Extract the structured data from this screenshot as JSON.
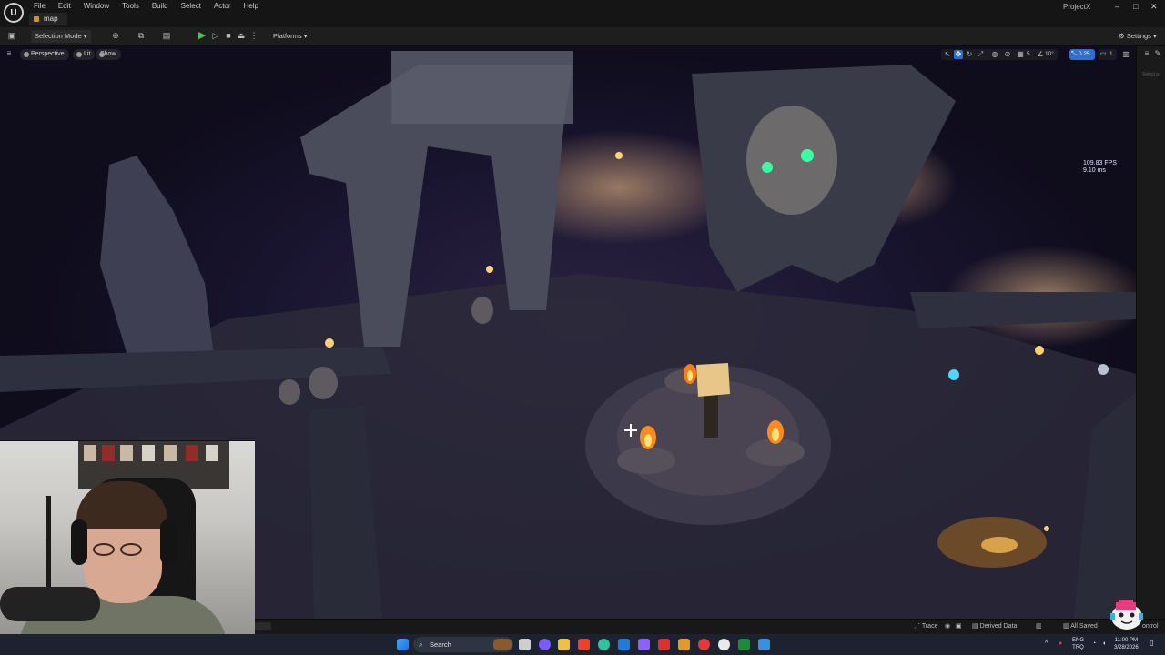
{
  "app": {
    "project_name": "ProjectX",
    "map_tab": "map",
    "menu": [
      "File",
      "Edit",
      "Window",
      "Tools",
      "Build",
      "Select",
      "Actor",
      "Help"
    ]
  },
  "toolbar": {
    "selection_mode": "Selection Mode",
    "platforms": "Platforms",
    "settings": "Settings"
  },
  "viewport": {
    "perspective": "Perspective",
    "lit": "Lit",
    "show": "Show",
    "grid_angle": "10°",
    "grid_snap": "5",
    "camera_speed": "0.25",
    "camera_count": "1",
    "fps": "109.83 FPS",
    "frame_ms": "9.10 ms"
  },
  "right_rail": {
    "hint": "Select a"
  },
  "status_bar": {
    "trace": "Trace",
    "derived_data": "Derived Data",
    "all_saved": "All Saved",
    "control": "ontrol"
  },
  "taskbar": {
    "search": "Search",
    "language_top": "ENG",
    "language_bottom": "TRQ",
    "time": "11:00 PM",
    "date": "3/28/2026"
  }
}
